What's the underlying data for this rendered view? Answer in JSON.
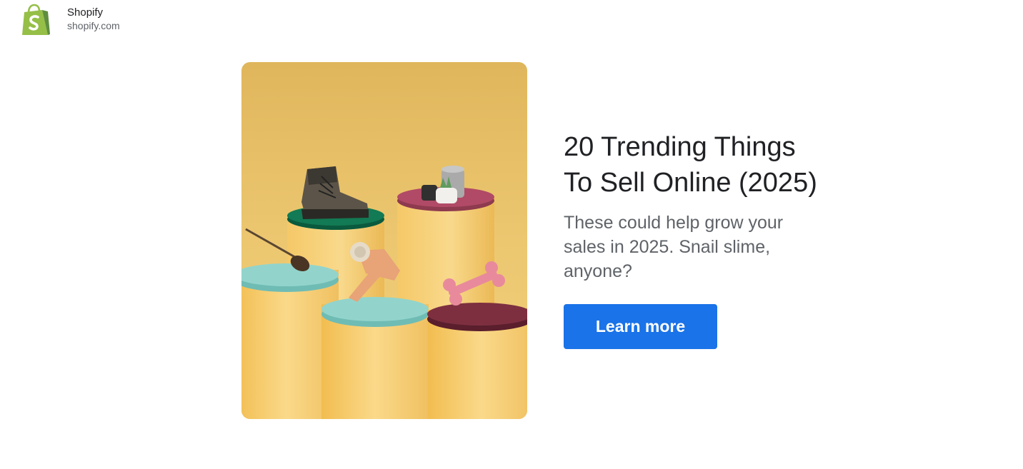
{
  "advertiser": {
    "name": "Shopify",
    "domain": "shopify.com",
    "logo_icon": "shopify-bag-icon",
    "logo_color": "#95bf47"
  },
  "ad": {
    "headline": "20 Trending Things\nTo Sell Online (2025)",
    "description": "These could help grow your sales in 2025. Snail slime, anyone?",
    "cta_label": "Learn more",
    "image_icon": "product-pedestals-image"
  },
  "colors": {
    "cta_background": "#1a73e8",
    "headline_text": "#202124",
    "description_text": "#5f6368",
    "image_background": "#e8b85a"
  }
}
